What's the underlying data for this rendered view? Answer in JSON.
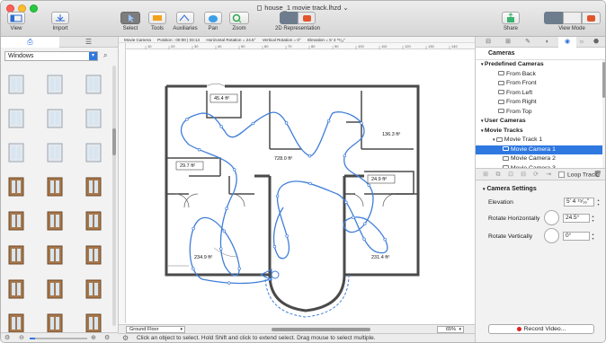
{
  "window": {
    "title": "house_1 movie track.lhzd",
    "title_icon": "document-icon",
    "title_chevron": "⌄"
  },
  "toolbar": {
    "view": "View",
    "import": "Import",
    "select": "Select",
    "tools": "Tools",
    "auxiliaries": "Auxiliaries",
    "pan": "Pan",
    "zoom": "Zoom",
    "representation": "2D Representation",
    "share": "Share",
    "view_mode": "View Mode"
  },
  "left_panel": {
    "tab_furniture_icon": "furniture-icon",
    "tab_list_icon": "list-icon",
    "category": "Windows",
    "search_icon": "search-icon",
    "catalog_count": 24
  },
  "infobar": {
    "camera": "Movie Camera",
    "position": "Position : 00:00 | 03:14",
    "horizontal": "Horizontal Rotation = 24.5°",
    "vertical": "Vertical Rotation = 0°",
    "elevation": "Elevation = 5' 4 ¹⁵⁄₁₆\""
  },
  "rulers": {
    "h_ticks": [
      "10",
      "20",
      "30",
      "40",
      "50",
      "60",
      "70",
      "80",
      "90",
      "100",
      "110",
      "120",
      "130",
      "140"
    ]
  },
  "plan": {
    "room_labels": [
      "45.4 ft²",
      "136.3 ft²",
      "29.7 ft²",
      "728.0 ft²",
      "24.9 ft²",
      "234.9 ft²",
      "231.4 ft²"
    ]
  },
  "bottom": {
    "level": "Ground Floor",
    "zoom": "65%",
    "status": "Click an object to select. Hold Shift and click to extend select. Drag mouse to select multiple."
  },
  "right_panel": {
    "header": "Cameras",
    "tree": [
      {
        "kind": "grp",
        "label": "Predefined Cameras"
      },
      {
        "kind": "it",
        "label": "From Back"
      },
      {
        "kind": "it",
        "label": "From Front"
      },
      {
        "kind": "it",
        "label": "From Left"
      },
      {
        "kind": "it",
        "label": "From Right"
      },
      {
        "kind": "it",
        "label": "From Top"
      },
      {
        "kind": "grp",
        "label": "User Cameras"
      },
      {
        "kind": "grp",
        "label": "Movie Tracks"
      },
      {
        "kind": "sub",
        "label": "Movie Track 1"
      },
      {
        "kind": "sub2",
        "label": "Movie Camera 1",
        "selected": true
      },
      {
        "kind": "sub2",
        "label": "Movie Camera 2"
      },
      {
        "kind": "sub2",
        "label": "Movie Camera 3"
      }
    ],
    "loop_track": "Loop Track",
    "settings_header": "Camera Settings",
    "elevation_label": "Elevation",
    "elevation_value": "5' 4 ¹⁵⁄₁₆\"",
    "rot_h_label": "Rotate Horizontally",
    "rot_h_value": "24.5°",
    "rot_v_label": "Rotate Vertically",
    "rot_v_value": "0°",
    "record": "Record Video..."
  },
  "colors": {
    "accent": "#2f78e0",
    "track": "#3f7ed8",
    "wall": "#4a4a4a",
    "record": "#e02020"
  }
}
